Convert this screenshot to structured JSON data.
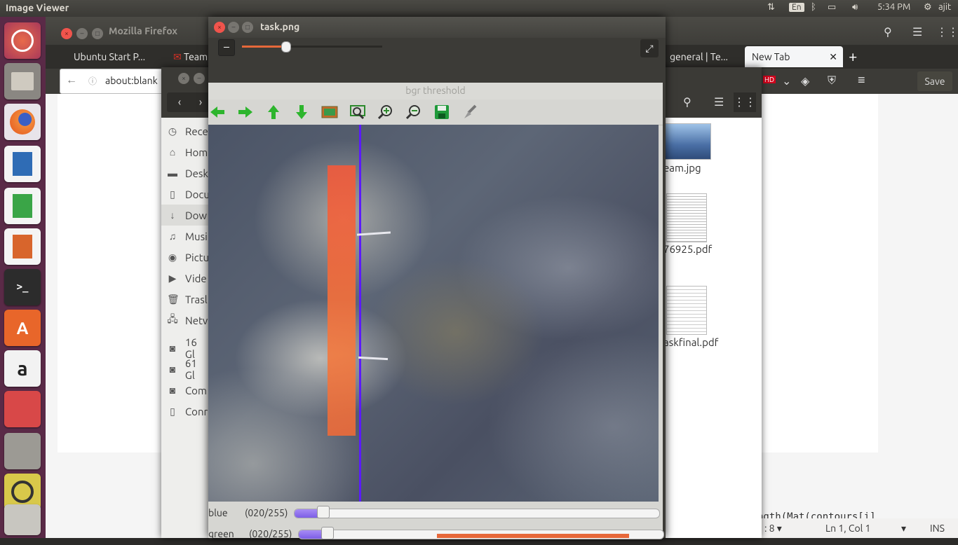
{
  "top_panel": {
    "app_title": "Image Viewer",
    "keyboard_layout": "En",
    "time": "5:34 PM",
    "user": "ajit"
  },
  "firefox": {
    "window_title": "Mozilla Firefox",
    "tabs": [
      {
        "label": "Ubuntu Start P..."
      },
      {
        "label": "Team"
      },
      {
        "label": "general | Te..."
      },
      {
        "label": "New Tab"
      }
    ],
    "url": "about:blank",
    "save_label": "Save",
    "hd_badge": "HD"
  },
  "file_manager": {
    "sidebar": [
      {
        "icon": "clock-icon",
        "label": "Rece"
      },
      {
        "icon": "home-icon",
        "label": "Hom"
      },
      {
        "icon": "folder-icon",
        "label": "Desk"
      },
      {
        "icon": "document-icon",
        "label": "Docu"
      },
      {
        "icon": "download-icon",
        "label": "Dow"
      },
      {
        "icon": "music-icon",
        "label": "Musi"
      },
      {
        "icon": "camera-icon",
        "label": "Pictu"
      },
      {
        "icon": "video-icon",
        "label": "Vide"
      },
      {
        "icon": "trash-icon",
        "label": "Trasl"
      },
      {
        "icon": "network-icon",
        "label": "Netv"
      },
      {
        "icon": "drive-icon",
        "label": "16 Gl"
      },
      {
        "icon": "drive-icon",
        "label": "61 Gl"
      },
      {
        "icon": "drive-icon",
        "label": "Com"
      },
      {
        "icon": "server-icon",
        "label": "Conr"
      }
    ],
    "files": [
      {
        "name": "eam.jpg"
      },
      {
        "name": "76925.pdf"
      },
      {
        "name": "askfinal.pdf"
      }
    ]
  },
  "image_viewer": {
    "title": "task.png",
    "zoom_fraction": 0.31
  },
  "opencv_window": {
    "title": "bgr threshold",
    "trackbars": [
      {
        "name": "blue",
        "value": "(020/255)",
        "fraction": 0.078
      },
      {
        "name": "green",
        "value": "(020/255)",
        "fraction": 0.078
      }
    ]
  },
  "editor": {
    "code_fragment": "ngth(Mat(contours[i]",
    "tab_width": ": 8",
    "position": "Ln 1, Col 1",
    "mode": "INS"
  },
  "colors": {
    "launcher_bg": "#5a2a47",
    "accent": "#e6683a",
    "blue_line": "#5a1bff"
  }
}
